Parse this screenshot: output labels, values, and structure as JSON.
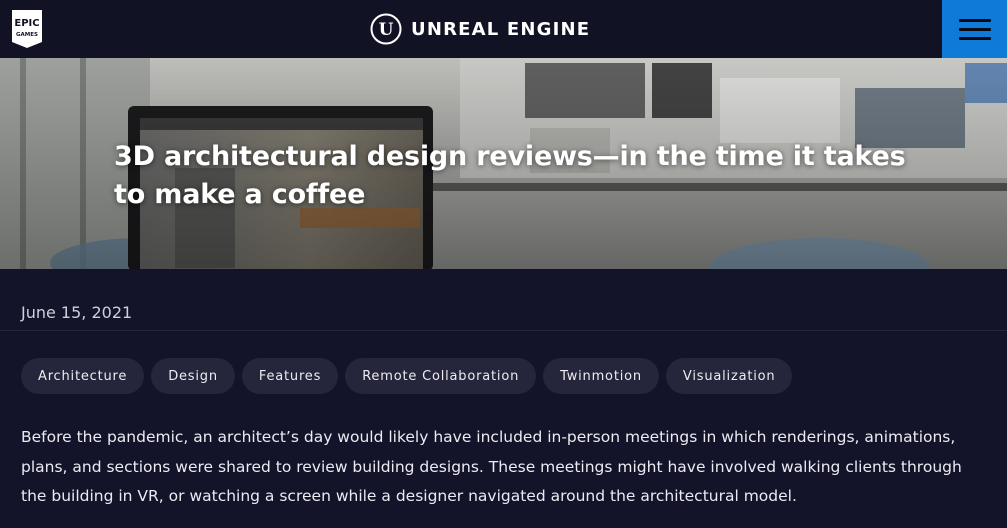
{
  "nav": {
    "epic_logo_line1": "EPIC",
    "epic_logo_line2": "GAMES",
    "brand_name": "UNREAL ENGINE",
    "brand_mark_letter": "U",
    "accent_color": "#0f7ad8",
    "menu_icon": "hamburger-icon"
  },
  "hero": {
    "title_line1": "3D architectural design reviews—in the time it takes",
    "title_line2": "to make a coffee"
  },
  "article": {
    "date": "June 15, 2021",
    "tags": [
      "Architecture",
      "Design",
      "Features",
      "Remote Collaboration",
      "Twinmotion",
      "Visualization"
    ],
    "paragraph": "Before the pandemic, an architect’s day would likely have included in-person meetings in which renderings, animations, plans, and sections were shared to review building designs. These meetings might have involved walking clients through the building in VR, or watching a screen while a designer navigated around the architectural model."
  }
}
